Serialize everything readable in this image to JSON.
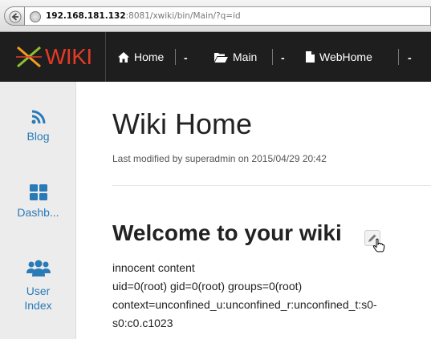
{
  "browser": {
    "url_host": "192.168.181.132",
    "url_rest": ":8081/xwiki/bin/Main/?q=id"
  },
  "navbar": {
    "logo_text": "WIKI",
    "crumbs": [
      {
        "label": "Home",
        "icon": "home-icon"
      },
      {
        "label": "Main",
        "icon": "folder-open-icon"
      },
      {
        "label": "WebHome",
        "icon": "file-icon"
      }
    ],
    "caret": "-"
  },
  "sidebar": {
    "items": [
      {
        "label": "Blog",
        "icon": "rss-icon"
      },
      {
        "label": "Dashb...",
        "icon": "dashboard-grid-icon"
      },
      {
        "label_line1": "User",
        "label_line2": "Index",
        "icon": "users-icon"
      }
    ]
  },
  "main": {
    "page_title": "Wiki Home",
    "last_modified": "Last modified by superadmin on 2015/04/29 20:42",
    "heading": "Welcome to your wiki",
    "lines": [
      "innocent content",
      "uid=0(root) gid=0(root) groups=0(root)",
      "context=unconfined_u:unconfined_r:unconfined_t:s0-",
      "s0:c0.c1023"
    ]
  },
  "colors": {
    "navbar_bg": "#1e1e1e",
    "logo_red": "#e53a27",
    "link_blue": "#2a7ab8",
    "sidebar_bg": "#ececec"
  }
}
